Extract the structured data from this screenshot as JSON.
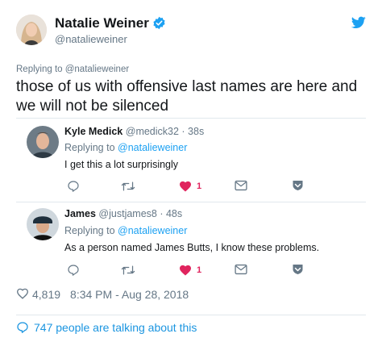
{
  "author": {
    "name": "Natalie Weiner",
    "handle": "@natalieweiner",
    "verified": true
  },
  "tweet": {
    "replying_label": "Replying to @natalieweiner",
    "text": "those of us with offensive last names are here and we will not be silenced"
  },
  "replies": [
    {
      "name": "Kyle Medick",
      "handle_time": "@medick32 · 38s",
      "replying_prefix": "Replying to ",
      "replying_link": "@natalieweiner",
      "text": "I get this a lot surprisingly",
      "like_count": "1"
    },
    {
      "name": "James",
      "handle_time": "@justjames8 · 48s",
      "replying_prefix": "Replying to ",
      "replying_link": "@natalieweiner",
      "text": "As a person named James Butts, I know these problems.",
      "like_count": "1"
    }
  ],
  "stats": {
    "likes": "4,819",
    "timestamp": "8:34 PM - Aug 28, 2018"
  },
  "footer": {
    "talking": "747 people are talking about this"
  },
  "icons": {
    "verified": "verified-badge-icon",
    "bird": "twitter-bird-icon",
    "reply": "reply-icon",
    "retweet": "retweet-icon",
    "like": "heart-icon",
    "dm": "envelope-icon",
    "more": "chevron-down-icon"
  },
  "colors": {
    "twitter_blue": "#1da1f2",
    "like_red": "#e0245e",
    "muted": "#657786",
    "text": "#14171a"
  }
}
